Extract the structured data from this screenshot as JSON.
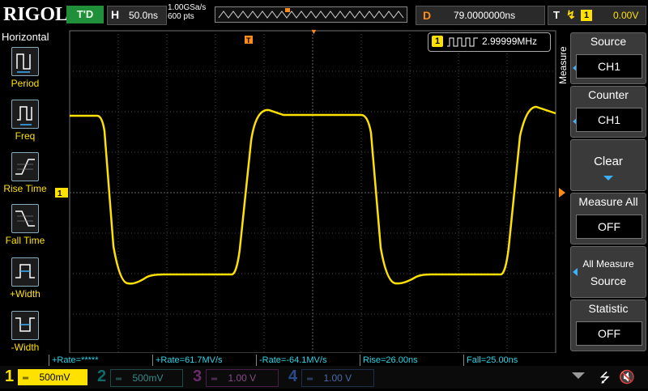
{
  "header": {
    "brand": "RIGOL",
    "trigger_status": "T'D",
    "horizontal_label": "H",
    "timebase": "50.0ns",
    "sample_rate": "1.00GSa/s",
    "memory_depth": "600 pts",
    "delay_label": "D",
    "delay_value": "79.0000000ns",
    "trigger_label": "T",
    "trigger_source": "1",
    "trigger_level": "0.00V"
  },
  "left_menu": {
    "title": "Horizontal",
    "items": [
      {
        "label": "Period",
        "icon": "period-icon"
      },
      {
        "label": "Freq",
        "icon": "freq-icon"
      },
      {
        "label": "Rise Time",
        "icon": "rise-time-icon"
      },
      {
        "label": "Fall Time",
        "icon": "fall-time-icon"
      },
      {
        "label": "+Width",
        "icon": "pos-width-icon"
      },
      {
        "label": "-Width",
        "icon": "neg-width-icon"
      }
    ]
  },
  "counter": {
    "channel": "1",
    "value": "2.99999MHz"
  },
  "right_menu": {
    "side_title": "Measure",
    "source": {
      "title": "Source",
      "value": "CH1"
    },
    "counter": {
      "title": "Counter",
      "value": "CH1"
    },
    "clear": {
      "title": "Clear"
    },
    "measure_all": {
      "title": "Measure All",
      "value": "OFF"
    },
    "all_measure_source": {
      "title_line1": "All Measure",
      "title_line2": "Source"
    },
    "statistic": {
      "title": "Statistic",
      "value": "OFF"
    }
  },
  "measurements": [
    "+Rate=*****",
    "+Rate=61.7MV/s",
    "-Rate=-64.1MV/s",
    "Rise=26.00ns",
    "Fall=25.00ns"
  ],
  "channels": [
    {
      "num": "1",
      "scale": "500mV",
      "color": "#ffe100",
      "active": true
    },
    {
      "num": "2",
      "scale": "500mV",
      "color": "#00c8c8",
      "active": false
    },
    {
      "num": "3",
      "scale": "1.00 V",
      "color": "#ff3cff",
      "active": false
    },
    {
      "num": "4",
      "scale": "1.00 V",
      "color": "#3a7bff",
      "active": false
    }
  ],
  "colors": {
    "ch1": "#ffe100",
    "grid": "#5a5a5a",
    "trigger_marker": "#ff8c1a"
  }
}
